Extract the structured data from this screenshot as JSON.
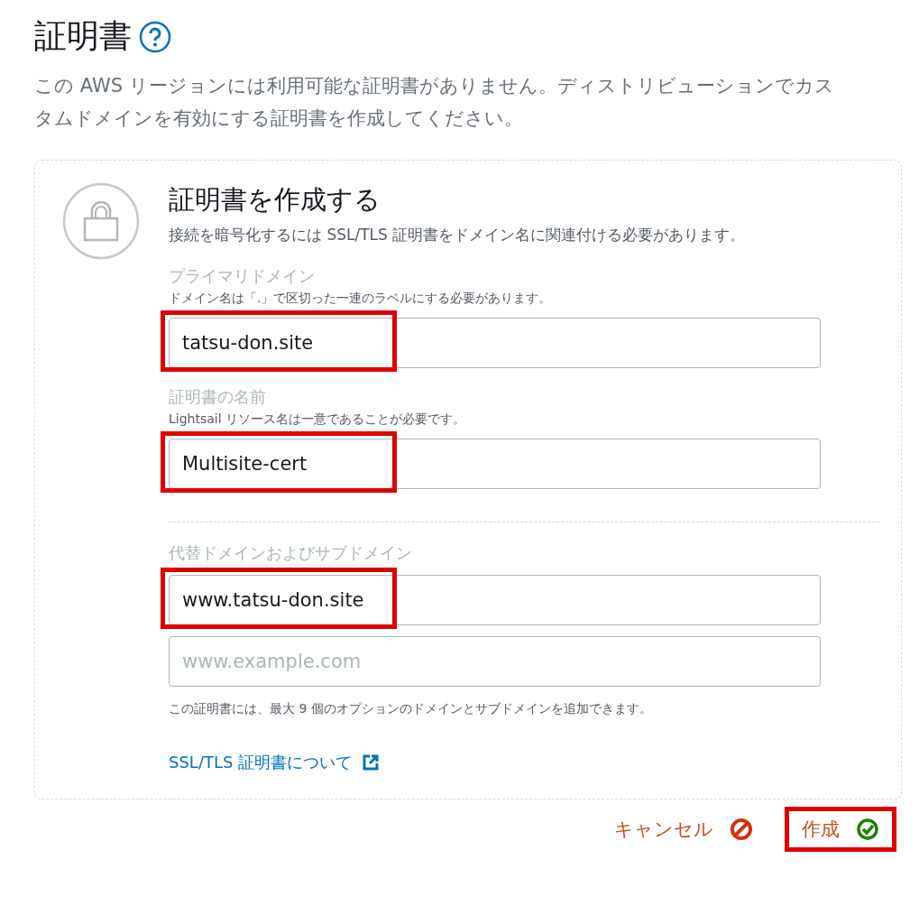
{
  "page": {
    "title": "証明書",
    "description": "この AWS リージョンには利用可能な証明書がありません。ディストリビューションでカスタムドメインを有効にする証明書を作成してください。"
  },
  "card": {
    "title": "証明書を作成する",
    "subtitle": "接続を暗号化するには SSL/TLS 証明書をドメイン名に関連付ける必要があります。",
    "fields": [
      {
        "label": "プライマリドメイン",
        "hint": "ドメイン名は「.」で区切った一連のラベルにする必要があります。",
        "value": "tatsu-don.site",
        "highlighted": true
      },
      {
        "label": "証明書の名前",
        "hint": "Lightsail リソース名は一意であることが必要です。",
        "value": "Multisite-cert",
        "highlighted": true
      }
    ],
    "alternates": {
      "label": "代替ドメインおよびサブドメイン",
      "inputs": [
        {
          "value": "www.tatsu-don.site",
          "highlighted": true
        },
        {
          "placeholder": "www.example.com",
          "highlighted": false
        }
      ],
      "note": "この証明書には、最大 9 個のオプションのドメインとサブドメインを追加できます。"
    },
    "link": "SSL/TLS 証明書について"
  },
  "actions": [
    {
      "kind": "cancel",
      "label": "キャンセル",
      "highlighted": false
    },
    {
      "kind": "create",
      "label": "作成",
      "highlighted": true
    }
  ]
}
